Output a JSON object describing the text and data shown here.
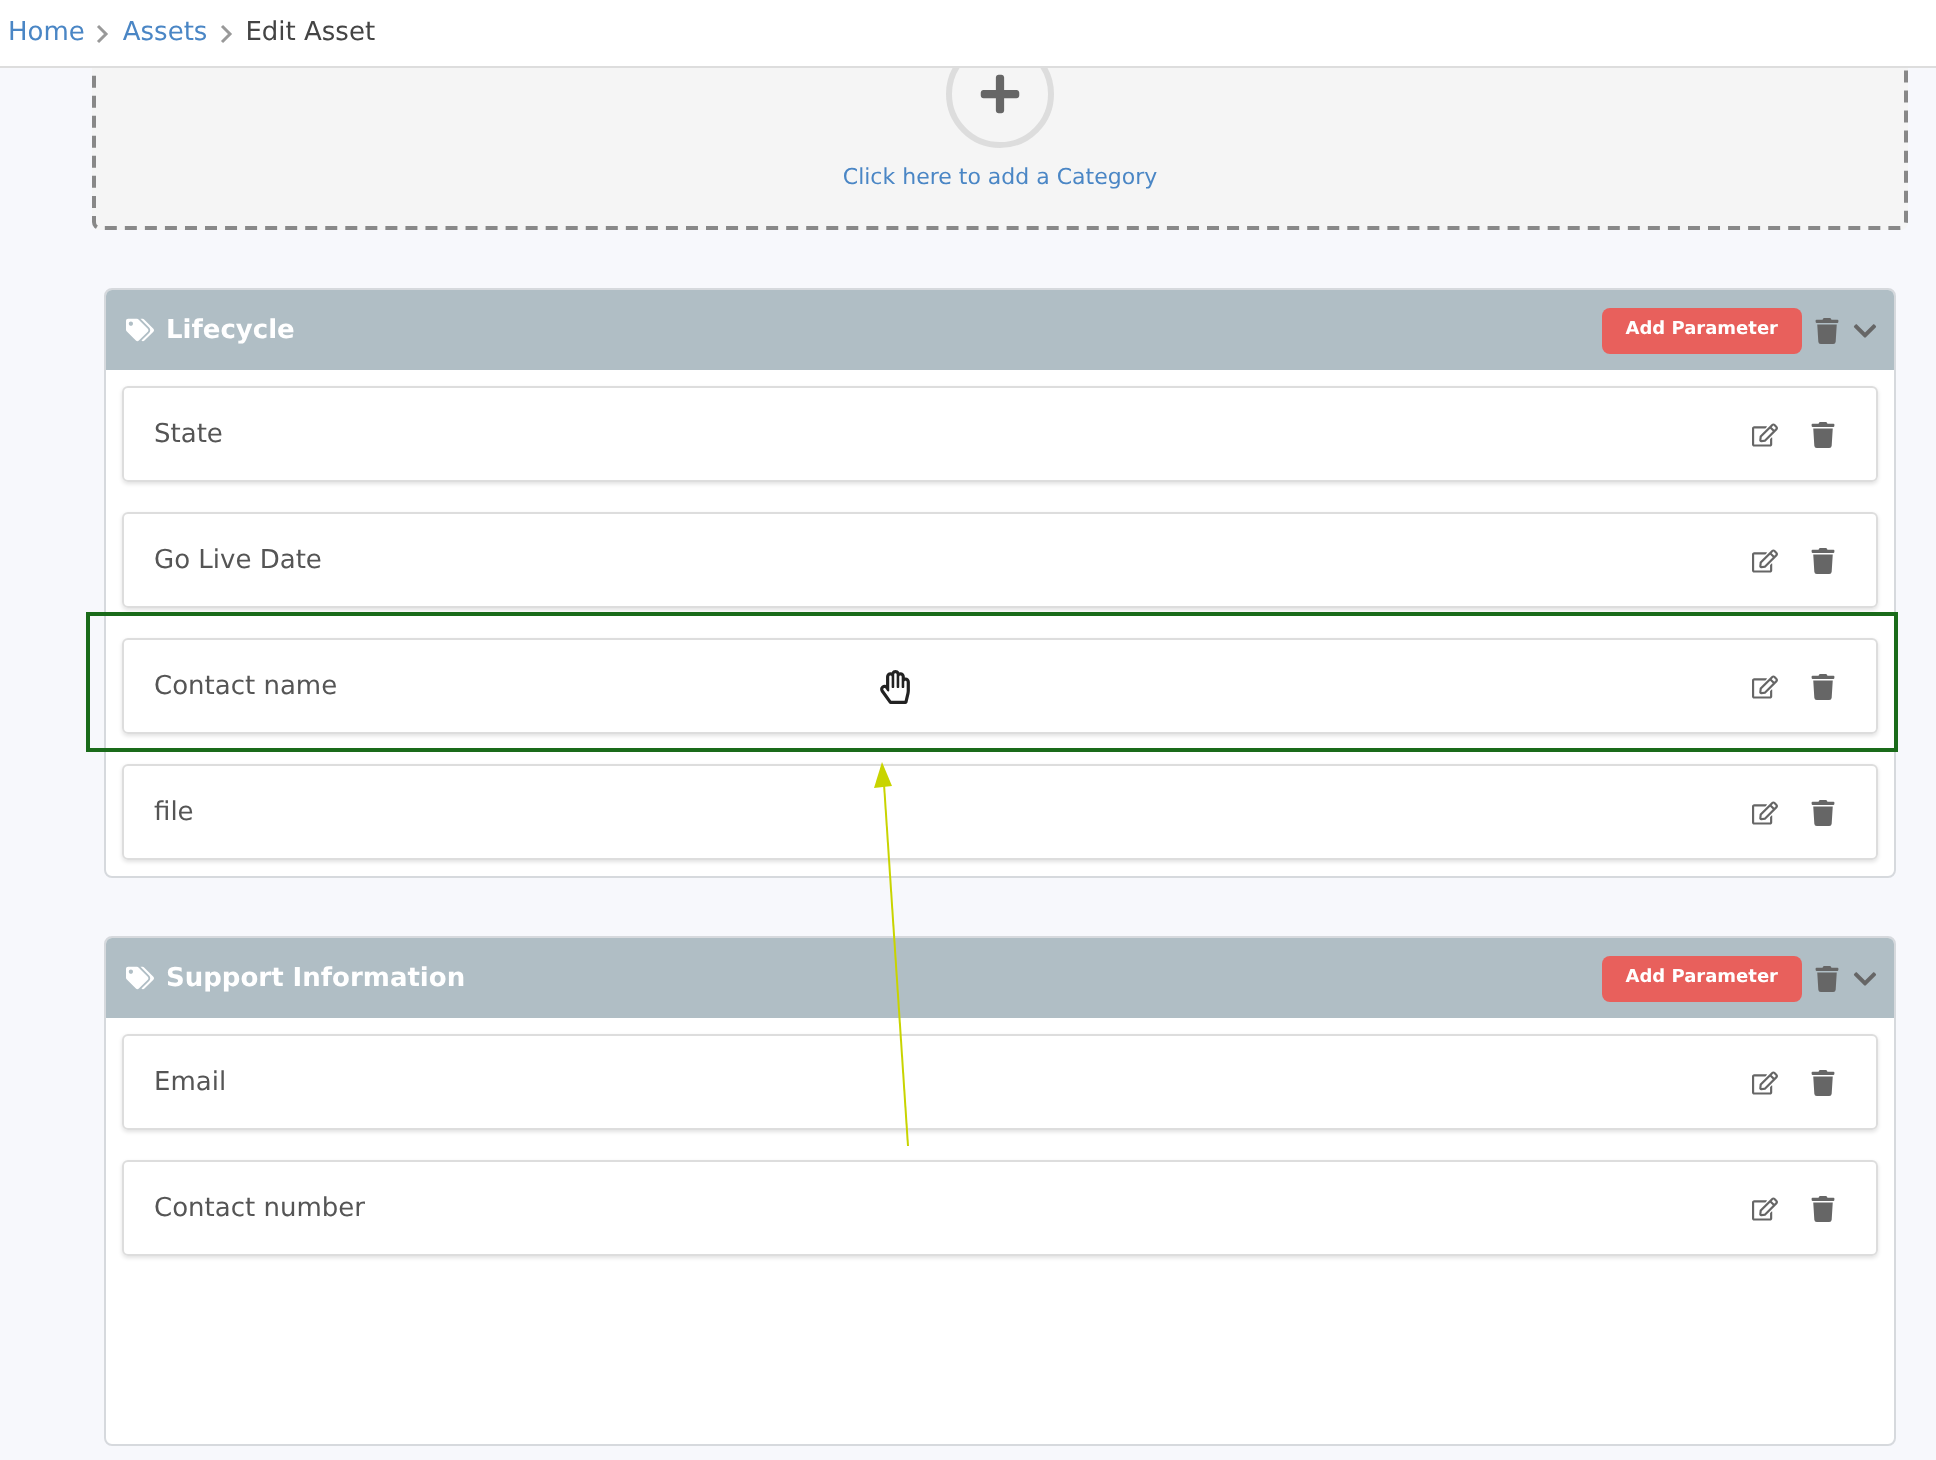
{
  "breadcrumb": [
    {
      "label": "Home",
      "link": true
    },
    {
      "label": "Assets",
      "link": true
    },
    {
      "label": "Edit Asset",
      "link": false
    }
  ],
  "add_category": {
    "label": "Click here to add a Category"
  },
  "categories": [
    {
      "title": "Lifecycle",
      "button": "Add Parameter",
      "parameters": [
        {
          "name": "State",
          "highlighted": false
        },
        {
          "name": "Go Live Date",
          "highlighted": false
        },
        {
          "name": "Contact name",
          "highlighted": true
        },
        {
          "name": "file",
          "highlighted": false
        }
      ]
    },
    {
      "title": "Support Information",
      "button": "Add Parameter",
      "parameters": [
        {
          "name": "Email",
          "highlighted": false
        },
        {
          "name": "Contact number",
          "highlighted": false
        }
      ]
    }
  ]
}
